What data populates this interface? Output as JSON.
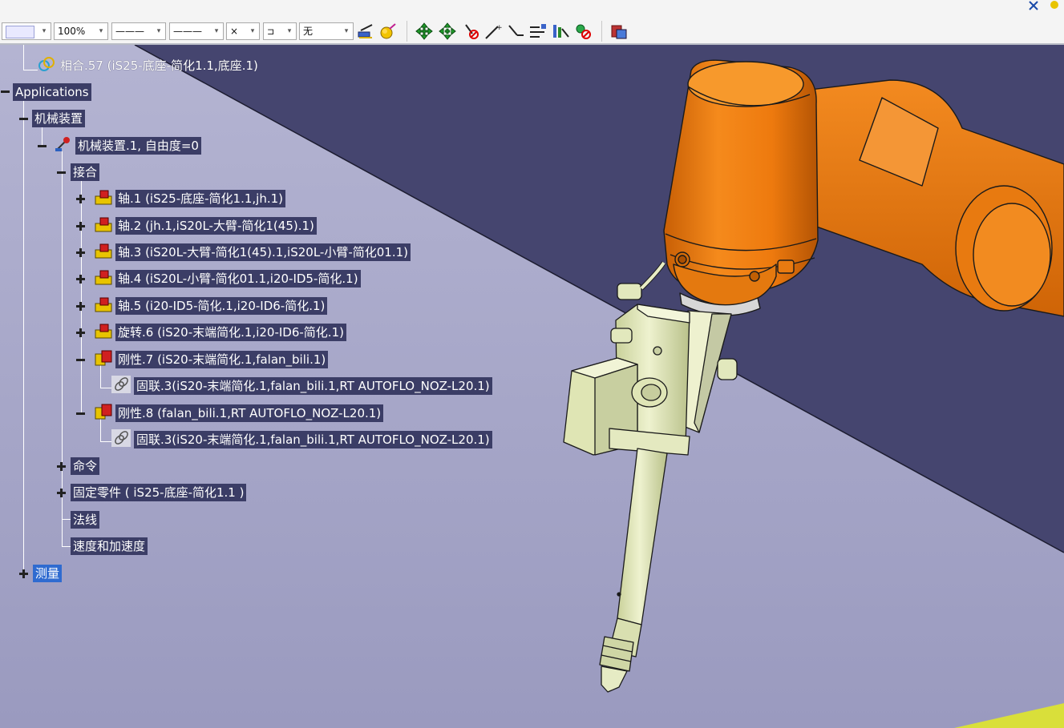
{
  "toolbar": {
    "color_value": "",
    "transparency_value": "100%",
    "linetype_value": "———",
    "lineweight_value": "———",
    "point_value": "×",
    "layer_value": "",
    "layer_none": "无",
    "icons": [
      "paint-brush-icon",
      "material-icon",
      "pan-icon",
      "rotate-icon",
      "hide-show-icon",
      "snap-point-icon",
      "snap-axis-icon",
      "reorder-icon",
      "dimension-icon",
      "hide-icon",
      "catalog-icon"
    ]
  },
  "tree": {
    "top_item": "相合.57 (iS25-底座-简化1.1,底座.1)",
    "applications": "Applications",
    "mechanism_device": "机械装置",
    "mechanism_instance": "机械装置.1, 自由度=0",
    "joints": "接合",
    "joint_items": [
      "轴.1 (iS25-底座-简化1.1,jh.1)",
      "轴.2 (jh.1,iS20L-大臂-简化1(45).1)",
      "轴.3 (iS20L-大臂-简化1(45).1,iS20L-小臂-简化01.1)",
      "轴.4 (iS20L-小臂-简化01.1,i20-ID5-简化.1)",
      "轴.5 (i20-ID5-简化.1,i20-ID6-简化.1)",
      "旋转.6 (iS20-末端简化.1,i20-ID6-简化.1)",
      "刚性.7 (iS20-末端简化.1,falan_bili.1)",
      "固联.3(iS20-末端简化.1,falan_bili.1,RT AUTOFLO_NOZ-L20.1)",
      "刚性.8 (falan_bili.1,RT AUTOFLO_NOZ-L20.1)",
      "固联.3(iS20-末端简化.1,falan_bili.1,RT AUTOFLO_NOZ-L20.1)"
    ],
    "commands": "命令",
    "fixed_part": "固定零件 ( iS25-底座-简化1.1 )",
    "laws": "法线",
    "speed_accel": "速度和加速度",
    "measure": "测量"
  },
  "colors": {
    "bg_dark": "#45456f",
    "bg_light": "#a3a3c6",
    "robot_orange": "#ef7f12",
    "tool_green": "#dfe6b4",
    "label_bg": "#3b3d66",
    "selected": "#2f6bd0"
  }
}
